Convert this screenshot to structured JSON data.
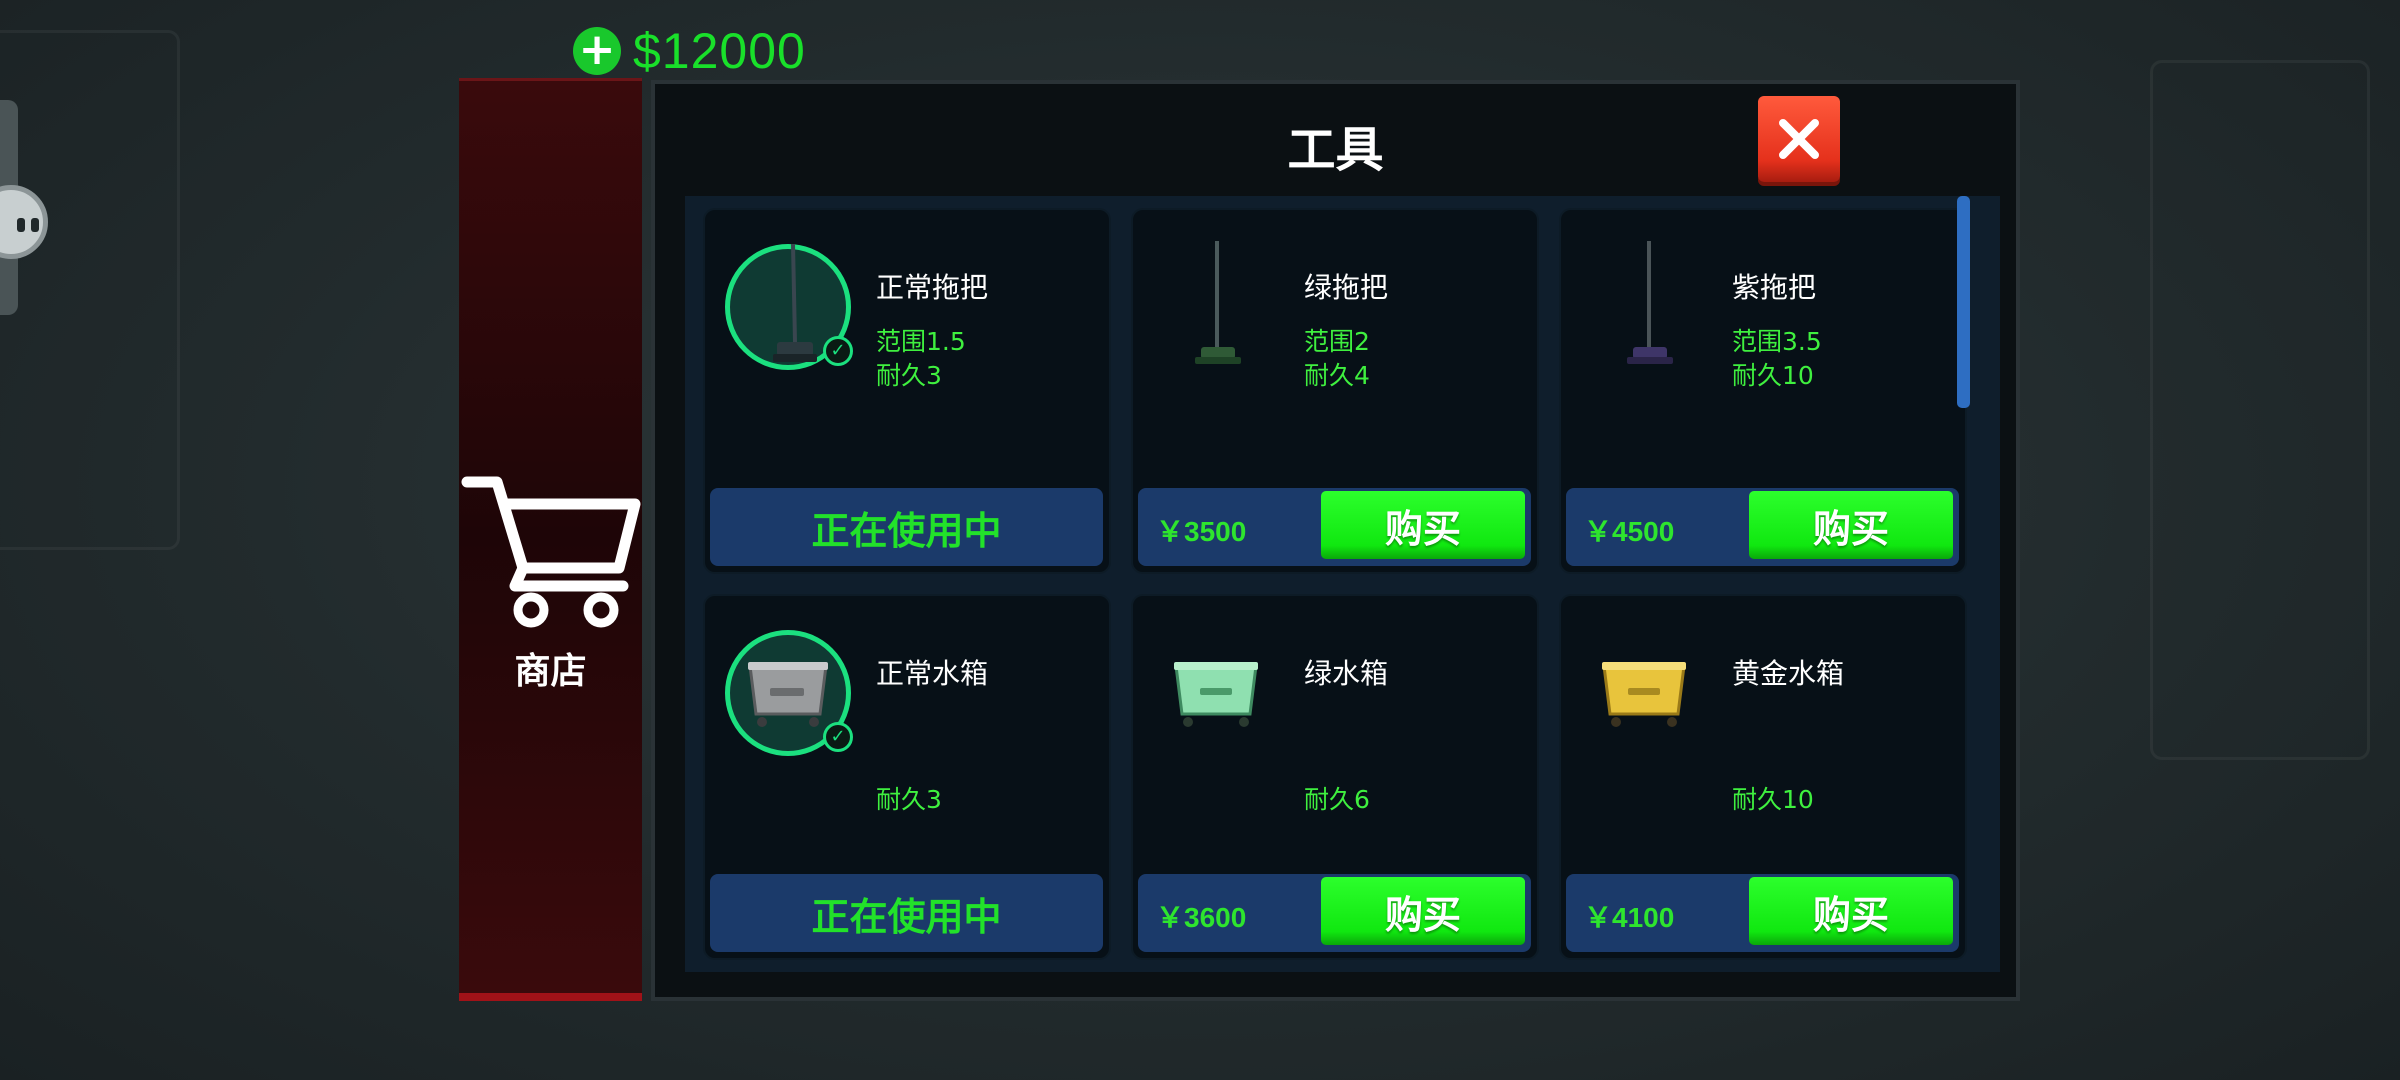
{
  "hud": {
    "money": "$12000",
    "money_plus": "+"
  },
  "sidebar": {
    "shop_label": "商店"
  },
  "panel": {
    "title": "工具",
    "close_icon": "close-icon"
  },
  "items": [
    {
      "name": "正常拖把",
      "stat1": "范围1.5",
      "stat2": "耐久3",
      "state": "in-use",
      "button": "正在使用中",
      "icon": "mop-icon",
      "color": "#1f6e58"
    },
    {
      "name": "绿拖把",
      "stat1": "范围2",
      "stat2": "耐久4",
      "state": "buy",
      "price": "￥3500",
      "button": "购买",
      "icon": "mop-icon",
      "color": "#2f7a3a"
    },
    {
      "name": "紫拖把",
      "stat1": "范围3.5",
      "stat2": "耐久10",
      "state": "buy",
      "price": "￥4500",
      "button": "购买",
      "icon": "mop-icon",
      "color": "#4a3a7a"
    },
    {
      "name": "正常水箱",
      "stat1": "",
      "stat2": "耐久3",
      "state": "in-use",
      "button": "正在使用中",
      "icon": "water-tank-icon",
      "color": "#8a8a8a"
    },
    {
      "name": "绿水箱",
      "stat1": "",
      "stat2": "耐久6",
      "state": "buy",
      "price": "￥3600",
      "button": "购买",
      "icon": "water-tank-icon",
      "color": "#7fd3a5"
    },
    {
      "name": "黄金水箱",
      "stat1": "",
      "stat2": "耐久10",
      "state": "buy",
      "price": "￥4100",
      "button": "购买",
      "icon": "water-tank-icon",
      "color": "#e6c43a"
    }
  ],
  "colors": {
    "accent_green": "#22e22a",
    "buy_green": "#10e810",
    "close_red": "#e5311c",
    "panel_bg": "#0b1013"
  }
}
